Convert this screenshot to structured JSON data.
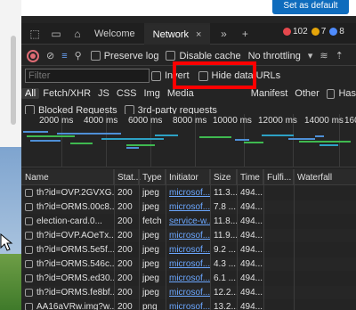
{
  "top_button": "Set as default",
  "tabs": [
    {
      "label": "Welcome"
    },
    {
      "label": "Network"
    }
  ],
  "status": {
    "errors": "102",
    "warnings": "7",
    "info": "8"
  },
  "toolbar": {
    "preserve_log": "Preserve log",
    "disable_cache": "Disable cache",
    "throttling": "No throttling"
  },
  "filter": {
    "placeholder": "Filter",
    "invert": "Invert",
    "hide_data_urls": "Hide data URLs"
  },
  "types": [
    "All",
    "Fetch/XHR",
    "JS",
    "CSS",
    "Img",
    "Media",
    "Manifest",
    "Other",
    "Has"
  ],
  "blocked": {
    "blocked_requests": "Blocked Requests",
    "third_party": "3rd-party requests"
  },
  "timeline_ticks": [
    "2000 ms",
    "4000 ms",
    "6000 ms",
    "8000 ms",
    "10000 ms",
    "12000 ms",
    "14000 ms",
    "1600"
  ],
  "columns": [
    "Name",
    "Stat...",
    "Type",
    "Initiator",
    "Size",
    "Time",
    "Fulfi...",
    "Waterfall"
  ],
  "rows": [
    {
      "name": "th?id=OVP.2GVXG...",
      "status": "200",
      "type": "jpeg",
      "initiator": "microsof...",
      "size": "11.3...",
      "time": "494..."
    },
    {
      "name": "th?id=ORMS.00c8...",
      "status": "200",
      "type": "jpeg",
      "initiator": "microsof...",
      "size": "7.8 ...",
      "time": "494..."
    },
    {
      "name": "election-card.0...",
      "status": "200",
      "type": "fetch",
      "initiator": "service-w...",
      "size": "11.8...",
      "time": "494..."
    },
    {
      "name": "th?id=OVP.AOeTx...",
      "status": "200",
      "type": "jpeg",
      "initiator": "microsof...",
      "size": "11.9...",
      "time": "494..."
    },
    {
      "name": "th?id=ORMS.5e5f...",
      "status": "200",
      "type": "jpeg",
      "initiator": "microsof...",
      "size": "9.2 ...",
      "time": "494..."
    },
    {
      "name": "th?id=ORMS.546c...",
      "status": "200",
      "type": "jpeg",
      "initiator": "microsof...",
      "size": "4.3 ...",
      "time": "494..."
    },
    {
      "name": "th?id=ORMS.ed30...",
      "status": "200",
      "type": "jpeg",
      "initiator": "microsof...",
      "size": "6.1 ...",
      "time": "494..."
    },
    {
      "name": "th?id=ORMS.fe8bf...",
      "status": "200",
      "type": "jpeg",
      "initiator": "microsof...",
      "size": "12.2...",
      "time": "494..."
    },
    {
      "name": "AA16aVRw.img?w...",
      "status": "200",
      "type": "png",
      "initiator": "microsof...",
      "size": "13.2...",
      "time": "494..."
    }
  ]
}
